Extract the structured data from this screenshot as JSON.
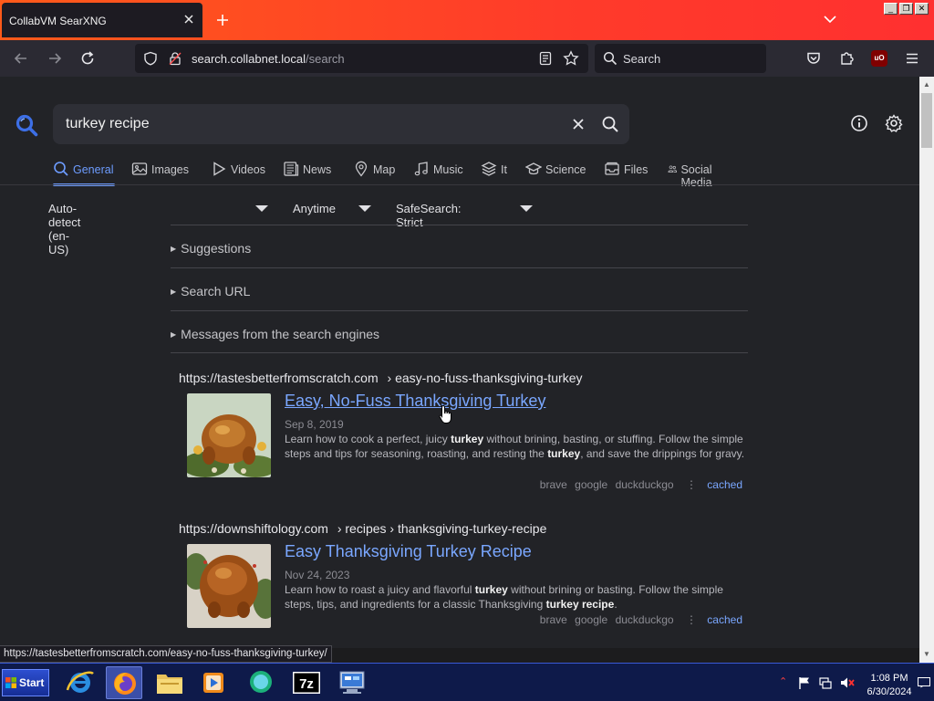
{
  "browser": {
    "tab_title": "CollabVM SearXNG",
    "url_host": "search.collabnet.local",
    "url_path": "/search",
    "search_placeholder": "Search",
    "status_url": "https://tastesbetterfromscratch.com/easy-no-fuss-thanksgiving-turkey/",
    "colors": {
      "accent": "#ff5a1a",
      "link": "#7aa7ff",
      "active_category": "#6d9cff"
    }
  },
  "search": {
    "query": "turkey recipe",
    "categories": [
      {
        "label": "General",
        "icon": "search-icon",
        "active": true
      },
      {
        "label": "Images",
        "icon": "image-icon",
        "active": false
      },
      {
        "label": "Videos",
        "icon": "play-icon",
        "active": false
      },
      {
        "label": "News",
        "icon": "newspaper-icon",
        "active": false
      },
      {
        "label": "Map",
        "icon": "map-pin-icon",
        "active": false
      },
      {
        "label": "Music",
        "icon": "music-note-icon",
        "active": false
      },
      {
        "label": "It",
        "icon": "layers-icon",
        "active": false
      },
      {
        "label": "Science",
        "icon": "school-icon",
        "active": false
      },
      {
        "label": "Files",
        "icon": "file-tray-icon",
        "active": false
      },
      {
        "label": "Social Media",
        "icon": "people-icon",
        "active": false
      }
    ],
    "filters": {
      "language": "Auto-detect (en-US)",
      "time": "Anytime",
      "safesearch": "SafeSearch: Strict"
    },
    "sections": [
      "Suggestions",
      "Search URL",
      "Messages from the search engines"
    ]
  },
  "results": [
    {
      "url_host": "https://tastesbetterfromscratch.com",
      "url_path": "› easy-no-fuss-thanksgiving-turkey",
      "title": "Easy, No-Fuss Thanksgiving Turkey",
      "date": "Sep 8, 2019",
      "snippet_parts": [
        "Learn how to cook a perfect, juicy ",
        "turkey",
        " without brining, basting, or stuffing. Follow the simple steps and tips for seasoning, roasting, and resting the ",
        "turkey",
        ", and save the drippings for gravy."
      ],
      "engines": [
        "brave",
        "google",
        "duckduckgo"
      ],
      "cached_label": "cached"
    },
    {
      "url_host": "https://downshiftology.com",
      "url_path": "› recipes › thanksgiving-turkey-recipe",
      "title": "Easy Thanksgiving Turkey Recipe",
      "date": "Nov 24, 2023",
      "snippet_parts": [
        "Learn how to roast a juicy and flavorful ",
        "turkey",
        " without brining or basting. Follow the simple steps, tips, and ingredients for a classic Thanksgiving ",
        "turkey recipe",
        "."
      ],
      "engines": [
        "brave",
        "google",
        "duckduckgo"
      ],
      "cached_label": "cached"
    }
  ],
  "taskbar": {
    "start_label": "Start",
    "time": "1:08 PM",
    "date": "6/30/2024",
    "apps": [
      "internet-explorer-icon",
      "firefox-icon",
      "file-explorer-icon",
      "media-player-icon",
      "messenger-icon",
      "7zip-icon",
      "network-settings-icon"
    ]
  }
}
